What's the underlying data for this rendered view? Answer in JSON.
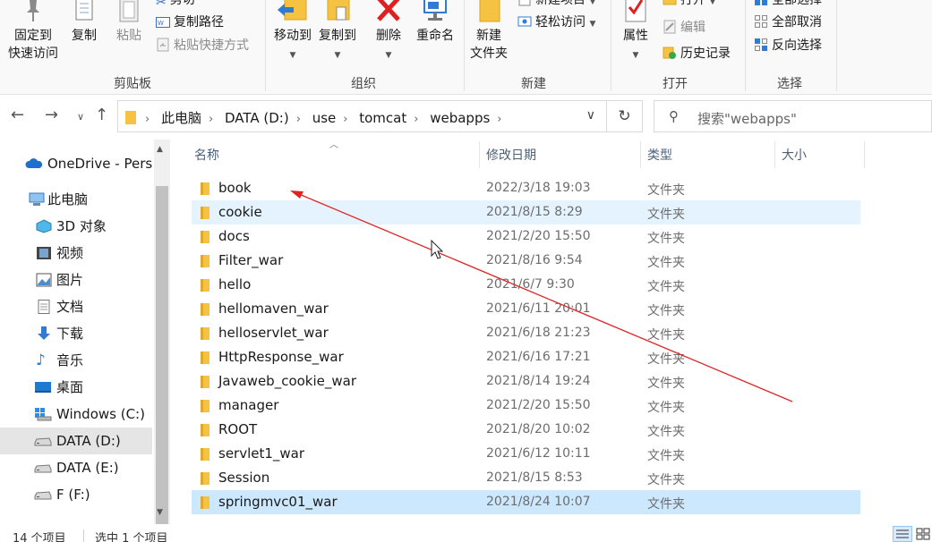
{
  "ribbon": {
    "clipboard": {
      "pin_label_1": "固定到",
      "pin_label_2": "快速访问",
      "copy_label": "复制",
      "paste_label": "粘贴",
      "cut_label": "剪切",
      "copy_path_label": "复制路径",
      "paste_shortcut_label": "粘贴快捷方式",
      "group_label": "剪贴板"
    },
    "organize": {
      "move_to_label": "移动到",
      "copy_to_label": "复制到",
      "delete_label": "删除",
      "rename_label": "重命名",
      "group_label": "组织"
    },
    "new": {
      "new_folder_label_1": "新建",
      "new_folder_label_2": "文件夹",
      "new_item_label": "新建项目",
      "easy_access_label": "轻松访问",
      "group_label": "新建"
    },
    "open": {
      "properties_label": "属性",
      "open_label": "打开",
      "edit_label": "编辑",
      "history_label": "历史记录",
      "group_label": "打开"
    },
    "select": {
      "select_all_label": "全部选择",
      "select_none_label": "全部取消",
      "invert_label": "反向选择",
      "group_label": "选择"
    }
  },
  "address": {
    "crumbs": [
      "此电脑",
      "DATA (D:)",
      "use",
      "tomcat",
      "webapps"
    ],
    "search_placeholder": "搜索\"webapps\""
  },
  "nav": {
    "items": [
      {
        "label": "OneDrive - Perso",
        "icon": "cloud-icon"
      },
      {
        "label": "此电脑",
        "icon": "computer-icon"
      },
      {
        "label": "3D 对象",
        "icon": "3d-objects-icon"
      },
      {
        "label": "视频",
        "icon": "video-icon"
      },
      {
        "label": "图片",
        "icon": "pictures-icon"
      },
      {
        "label": "文档",
        "icon": "documents-icon"
      },
      {
        "label": "下载",
        "icon": "download-icon"
      },
      {
        "label": "音乐",
        "icon": "music-icon"
      },
      {
        "label": "桌面",
        "icon": "desktop-icon"
      },
      {
        "label": "Windows (C:)",
        "icon": "windows-drive-icon"
      },
      {
        "label": "DATA (D:)",
        "icon": "drive-icon",
        "selected": true
      },
      {
        "label": "DATA (E:)",
        "icon": "drive-icon"
      },
      {
        "label": "F (F:)",
        "icon": "drive-icon"
      }
    ]
  },
  "columns": {
    "name": "名称",
    "date": "修改日期",
    "type": "类型",
    "size": "大小"
  },
  "files": [
    {
      "name": "book",
      "date": "2022/3/18 19:03",
      "type": "文件夹"
    },
    {
      "name": "cookie",
      "date": "2021/8/15 8:29",
      "type": "文件夹"
    },
    {
      "name": "docs",
      "date": "2021/2/20 15:50",
      "type": "文件夹"
    },
    {
      "name": "Filter_war",
      "date": "2021/8/16 9:54",
      "type": "文件夹"
    },
    {
      "name": "hello",
      "date": "2021/6/7 9:30",
      "type": "文件夹"
    },
    {
      "name": "hellomaven_war",
      "date": "2021/6/11 20:01",
      "type": "文件夹"
    },
    {
      "name": "helloservlet_war",
      "date": "2021/6/18 21:23",
      "type": "文件夹"
    },
    {
      "name": "HttpResponse_war",
      "date": "2021/6/16 17:21",
      "type": "文件夹"
    },
    {
      "name": "Javaweb_cookie_war",
      "date": "2021/8/14 19:24",
      "type": "文件夹"
    },
    {
      "name": "manager",
      "date": "2021/2/20 15:50",
      "type": "文件夹"
    },
    {
      "name": "ROOT",
      "date": "2021/8/20 10:02",
      "type": "文件夹"
    },
    {
      "name": "servlet1_war",
      "date": "2021/6/12 10:11",
      "type": "文件夹"
    },
    {
      "name": "Session",
      "date": "2021/8/15 8:53",
      "type": "文件夹"
    },
    {
      "name": "springmvc01_war",
      "date": "2021/8/24 10:07",
      "type": "文件夹"
    }
  ],
  "status": {
    "count": "14 个项目",
    "selected": "选中 1 个项目"
  },
  "colors": {
    "selection": "#cce8ff",
    "hover": "#e5f3ff",
    "annotation_arrow": "#e02424",
    "folder": "#f5c242"
  }
}
